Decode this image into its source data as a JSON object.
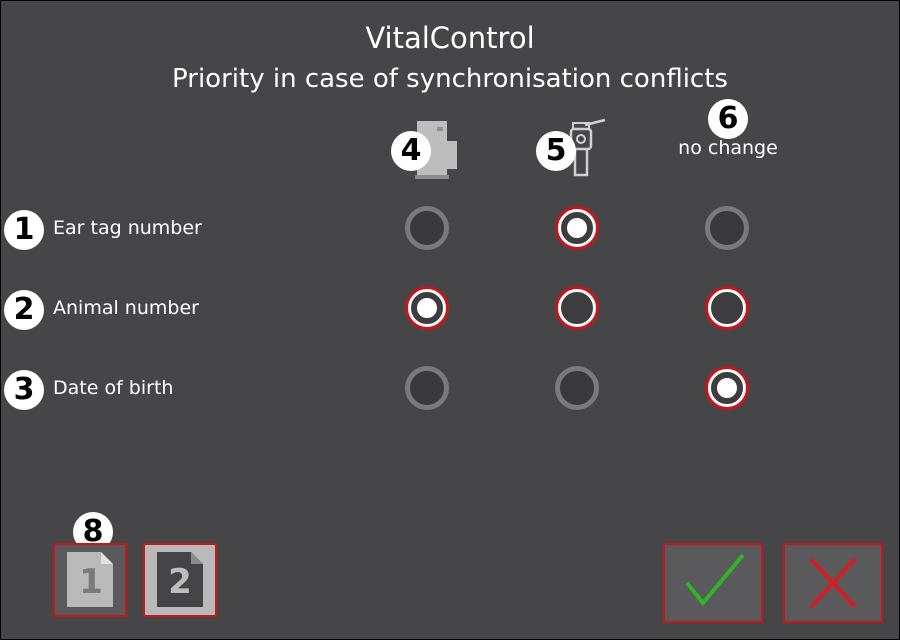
{
  "header": {
    "app_title": "VitalControl",
    "subtitle": "Priority in case of synchronisation conflicts"
  },
  "columns": [
    {
      "callout": "4",
      "icon": "base-station-icon"
    },
    {
      "callout": "5",
      "icon": "handheld-reader-icon"
    },
    {
      "callout": "6",
      "label": "no change"
    }
  ],
  "rows": [
    {
      "callout": "1",
      "label": "Ear tag number",
      "options": [
        "disabled",
        "checked",
        "disabled"
      ]
    },
    {
      "callout": "2",
      "label": "Animal number",
      "options": [
        "checked",
        "unchecked",
        "unchecked"
      ]
    },
    {
      "callout": "3",
      "label": "Date of birth",
      "options": [
        "disabled",
        "disabled",
        "checked"
      ]
    }
  ],
  "pagination": {
    "callout": "8",
    "pages": [
      "1",
      "2"
    ],
    "current_page": "1"
  },
  "actions": {
    "confirm_icon": "checkmark-icon",
    "cancel_icon": "close-icon"
  },
  "colors": {
    "background": "#464649",
    "accent_red": "#c6161c",
    "confirm_green": "#2fb52a"
  }
}
